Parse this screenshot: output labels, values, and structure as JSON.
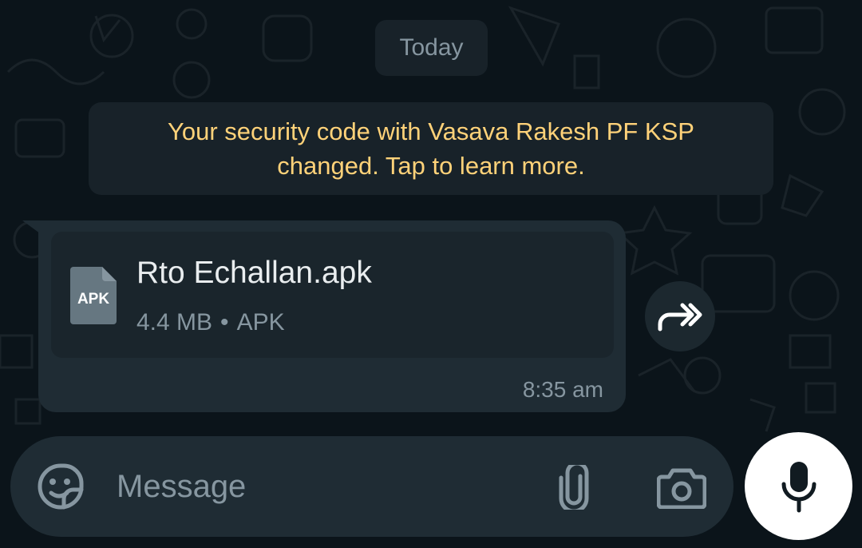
{
  "chat": {
    "date_label": "Today",
    "security_notice": "Your security code with Vasava Rakesh PF KSP changed. Tap to learn more.",
    "message": {
      "file_type_badge": "APK",
      "file_name": "Rto Echallan.apk",
      "file_size": "4.4 MB",
      "meta_separator": "•",
      "file_type": "APK",
      "time": "8:35 am"
    }
  },
  "composer": {
    "placeholder": "Message"
  },
  "icons": {
    "forward": "forward-icon",
    "emoji": "sticker-emoji-icon",
    "attach": "paperclip-icon",
    "camera": "camera-icon",
    "mic": "microphone-icon",
    "file": "apk-file-icon"
  },
  "colors": {
    "background": "#0b141a",
    "bubble": "#1f2c34",
    "security_text": "#ffd279",
    "primary_text": "#e9edef",
    "secondary_text": "#8696a0"
  }
}
